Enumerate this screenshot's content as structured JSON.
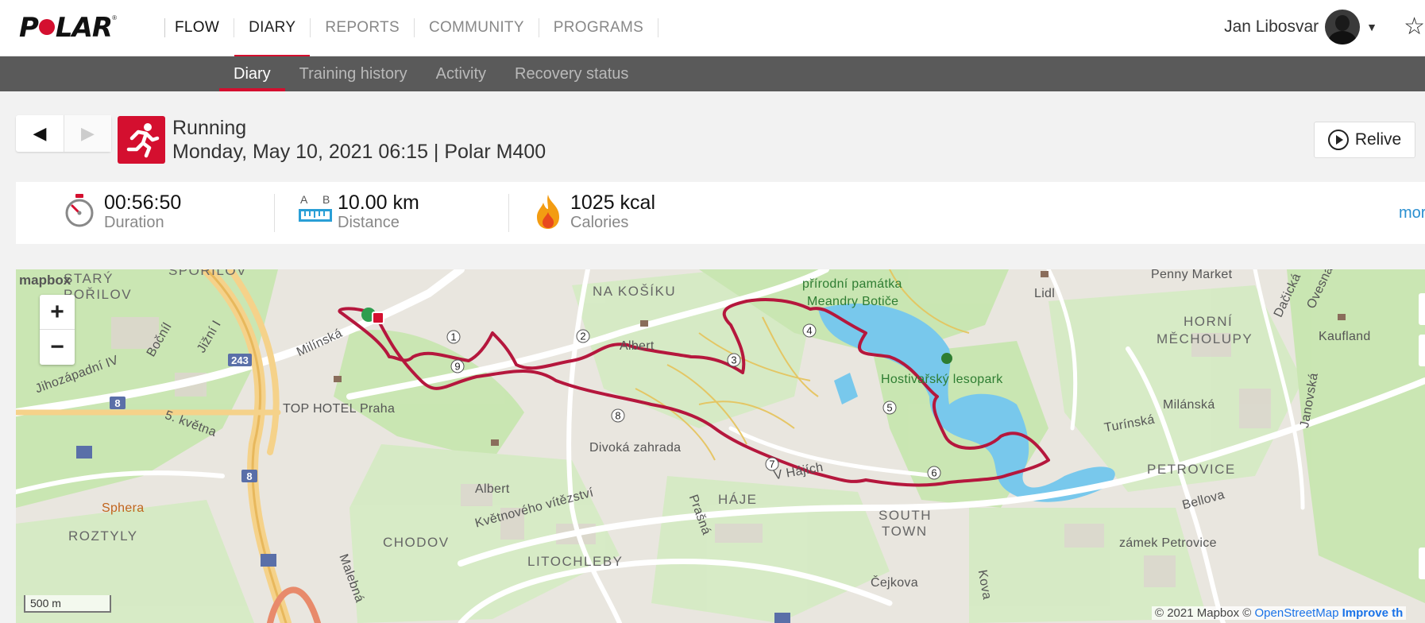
{
  "brand": {
    "logo": "POLAR",
    "flow": "FLOW"
  },
  "nav": {
    "items": [
      {
        "label": "DIARY",
        "active": true
      },
      {
        "label": "REPORTS"
      },
      {
        "label": "COMMUNITY"
      },
      {
        "label": "PROGRAMS"
      }
    ]
  },
  "user": {
    "name": "Jan Libosvar"
  },
  "subnav": {
    "items": [
      {
        "label": "Diary",
        "active": true
      },
      {
        "label": "Training history"
      },
      {
        "label": "Activity"
      },
      {
        "label": "Recovery status"
      }
    ]
  },
  "session": {
    "sport": "Running",
    "datetime": "Monday, May 10, 2021 06:15 | Polar M400",
    "relive_label": "Relive"
  },
  "stats": {
    "duration": {
      "value": "00:56:50",
      "label": "Duration"
    },
    "distance": {
      "value": "10.00 km",
      "label": "Distance",
      "a": "A",
      "b": "B"
    },
    "calories": {
      "value": "1025 kcal",
      "label": "Calories"
    },
    "more": "mor"
  },
  "map": {
    "brand": "mapbox",
    "scale": "500 m",
    "attribution": {
      "a": "© 2021 Mapbox ©",
      "b": "OpenStreetMap",
      "c": "Improve th"
    },
    "labels": [
      {
        "t": "SPOŘILOV",
        "c": "big"
      },
      {
        "t": "STARÝ",
        "c": "big"
      },
      {
        "t": "POŘILOV",
        "c": "big"
      },
      {
        "t": "Bočníl"
      },
      {
        "t": "Jižní I"
      },
      {
        "t": "Milínská"
      },
      {
        "t": "Jihozápadní IV"
      },
      {
        "t": "5. května"
      },
      {
        "t": "TOP HOTEL Praha"
      },
      {
        "t": "Sphera",
        "c": "orange"
      },
      {
        "t": "ROZTYLY",
        "c": "big"
      },
      {
        "t": "NA KOŠÍKU",
        "c": "big"
      },
      {
        "t": "Albert"
      },
      {
        "t": "Albert"
      },
      {
        "t": "Divoká zahrada"
      },
      {
        "t": "přírodní památka",
        "c": "green"
      },
      {
        "t": "Meandry Botiče",
        "c": "green"
      },
      {
        "t": "Lidl"
      },
      {
        "t": "Penny Market"
      },
      {
        "t": "Hostivařský lesopark",
        "c": "green"
      },
      {
        "t": "HORNÍ",
        "c": "big"
      },
      {
        "t": "MĚCHOLUPY",
        "c": "big"
      },
      {
        "t": "Kaufland"
      },
      {
        "t": "Dačická"
      },
      {
        "t": "Ovesná"
      },
      {
        "t": "Milánská"
      },
      {
        "t": "Turínská"
      },
      {
        "t": "Janovská"
      },
      {
        "t": "PETROVICE",
        "c": "big"
      },
      {
        "t": "Bellova"
      },
      {
        "t": "zámek Petrovice"
      },
      {
        "t": "V Hájích"
      },
      {
        "t": "HÁJE",
        "c": "big"
      },
      {
        "t": "SOUTH",
        "c": "big"
      },
      {
        "t": "TOWN",
        "c": "big"
      },
      {
        "t": "Květnového vítězství"
      },
      {
        "t": "Prašná"
      },
      {
        "t": "CHODOV",
        "c": "big"
      },
      {
        "t": "LITOCHLEBY",
        "c": "big"
      },
      {
        "t": "Malebná"
      },
      {
        "t": "Čejkova"
      },
      {
        "t": "Kova"
      }
    ],
    "roads": [
      "243",
      "8",
      "8"
    ],
    "km_markers": [
      "1",
      "2",
      "3",
      "4",
      "5",
      "6",
      "7",
      "8",
      "9"
    ]
  }
}
